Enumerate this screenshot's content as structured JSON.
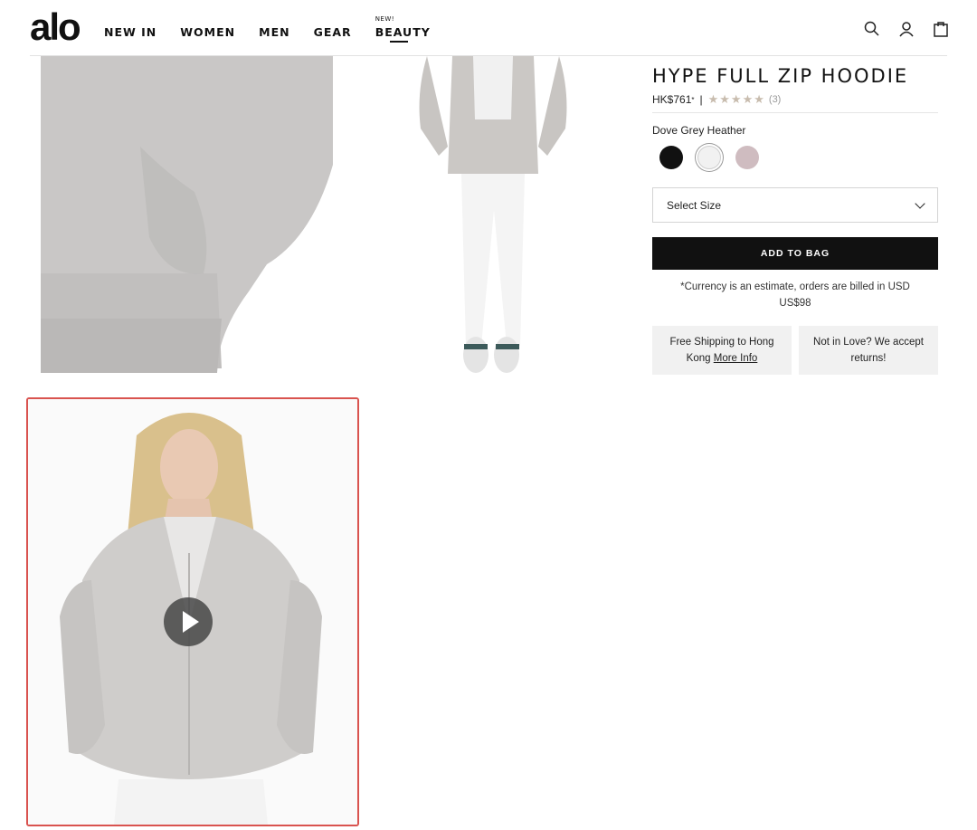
{
  "header": {
    "logo": "alo",
    "nav": [
      {
        "label": "NEW IN"
      },
      {
        "label": "WOMEN"
      },
      {
        "label": "MEN"
      },
      {
        "label": "GEAR"
      },
      {
        "label": "BEAUTY",
        "badge": "NEW!"
      }
    ],
    "icons": [
      "search-icon",
      "account-icon",
      "bag-icon"
    ]
  },
  "product": {
    "title": "HYPE FULL ZIP HOODIE",
    "price": "HK$761",
    "price_marker": "*",
    "separator": "|",
    "stars": "★★★★★",
    "reviews": "(3)",
    "rating": 5,
    "color_name": "Dove Grey Heather",
    "swatches": [
      {
        "name": "black",
        "hex": "#111111"
      },
      {
        "name": "dove-grey-heather",
        "hex": "#f1f1f1",
        "selected": true
      },
      {
        "name": "mauve",
        "hex": "#cfbcc0"
      }
    ],
    "size_placeholder": "Select Size",
    "add_to_bag": "ADD TO BAG",
    "currency_note": "*Currency is an estimate, orders are billed in USD",
    "usd_price": "US$98",
    "shipping_text": "Free Shipping to Hong Kong",
    "shipping_link": "More Info",
    "returns_text": "Not in Love? We accept returns!"
  },
  "colors": {
    "accent": "#111111",
    "highlight_border": "#d9534f",
    "card_bg": "#f1f1f1"
  }
}
